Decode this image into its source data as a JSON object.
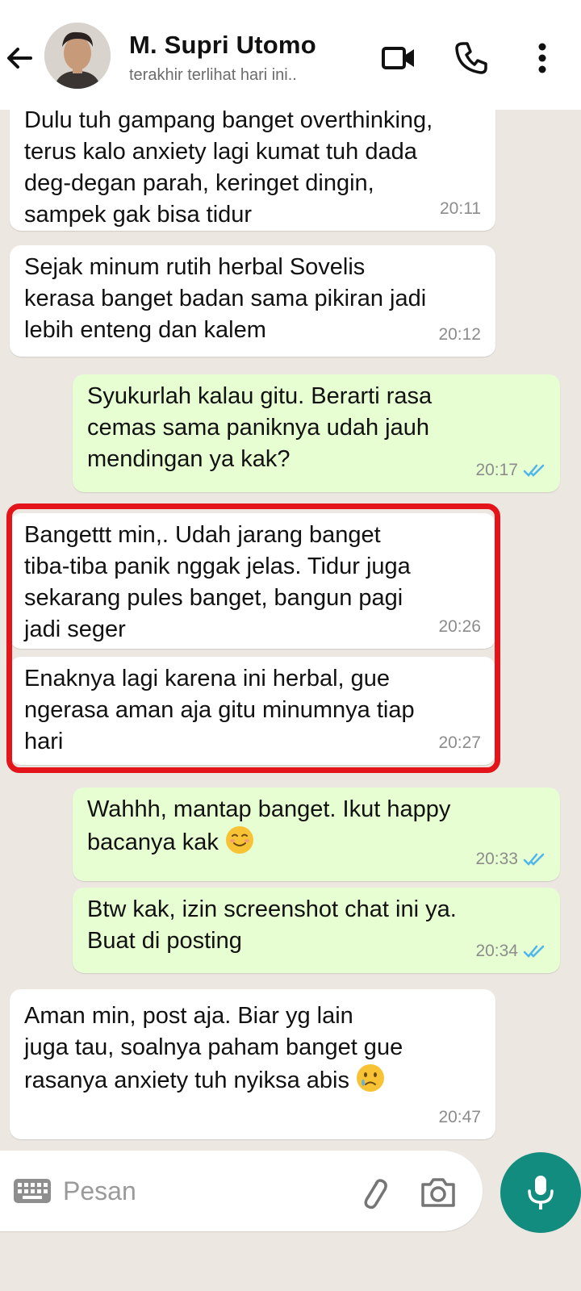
{
  "header": {
    "contact_name": "M. Supri Utomo",
    "status": "terakhir terlihat hari ini.."
  },
  "messages": [
    {
      "direction": "in",
      "text": "Dulu tuh gampang banget overthinking,\nterus kalo anxiety lagi kumat tuh dada\ndeg-degan parah, keringet dingin,\nsampek gak bisa tidur",
      "time": "20:11"
    },
    {
      "direction": "in",
      "text": "Sejak minum rutih herbal Sovelis\nkerasa banget badan sama pikiran jadi\nlebih enteng dan kalem",
      "time": "20:12"
    },
    {
      "direction": "out",
      "text": "Syukurlah kalau gitu. Berarti rasa\ncemas sama paniknya udah jauh\nmendingan ya kak?",
      "time": "20:17",
      "read": true
    },
    {
      "direction": "in",
      "text": "Bangettt min,. Udah jarang banget\ntiba-tiba panik nggak jelas. Tidur juga\nsekarang pules banget, bangun pagi\njadi seger",
      "time": "20:26",
      "highlighted": true
    },
    {
      "direction": "in",
      "text": "Enaknya lagi karena ini herbal, gue\nngerasa aman aja gitu minumnya tiap\nhari",
      "time": "20:27",
      "highlighted": true
    },
    {
      "direction": "out",
      "text": "Wahhh, mantap banget. Ikut happy\nbacanya kak",
      "emoji": "smiling-face-icon",
      "time": "20:33",
      "read": true
    },
    {
      "direction": "out",
      "text": "Btw kak, izin screenshot chat ini ya.\nBuat di posting",
      "time": "20:34",
      "read": true
    },
    {
      "direction": "in",
      "text": "Aman min, post aja. Biar yg lain\njuga tau, soalnya paham banget gue\nrasanya anxiety tuh nyiksa abis",
      "emoji": "sad-tear-face-icon",
      "time": "20:47"
    }
  ],
  "composer": {
    "placeholder": "Pesan"
  },
  "colors": {
    "incoming_bubble": "#ffffff",
    "outgoing_bubble": "#e6fed2",
    "highlight_border": "#e4141b",
    "read_ticks": "#4fb6ec",
    "mic_button": "#128c7e"
  }
}
